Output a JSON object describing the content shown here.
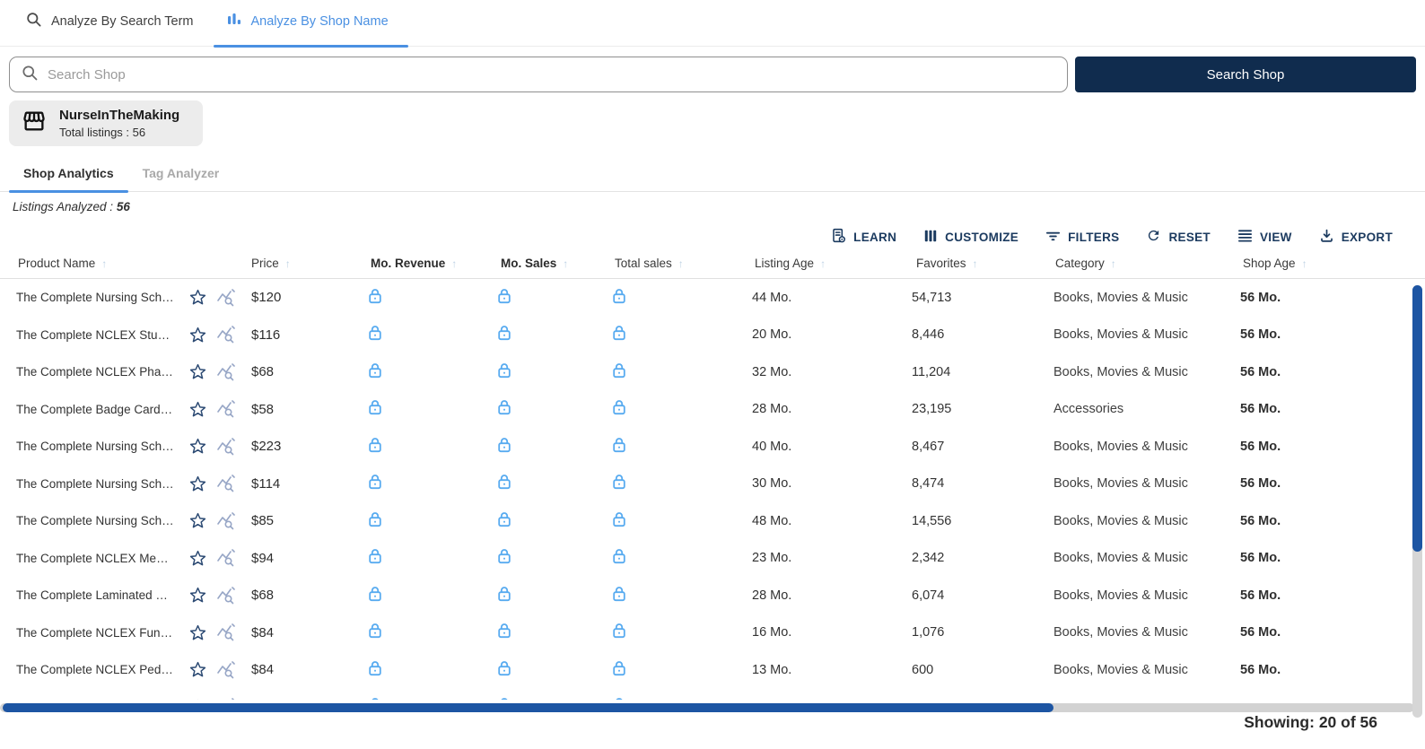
{
  "top_tabs": {
    "search_term": "Analyze By Search Term",
    "shop_name": "Analyze By Shop Name"
  },
  "search": {
    "placeholder": "Search Shop",
    "button_label": "Search Shop"
  },
  "shop_card": {
    "name": "NurseInTheMaking",
    "total_listings": "Total listings : 56"
  },
  "sub_tabs": {
    "shop_analytics": "Shop Analytics",
    "tag_analyzer": "Tag Analyzer"
  },
  "listings_analyzed": {
    "label": "Listings Analyzed : ",
    "value": "56"
  },
  "toolbar": {
    "learn": "LEARN",
    "customize": "CUSTOMIZE",
    "filters": "FILTERS",
    "reset": "RESET",
    "view": "VIEW",
    "export": "EXPORT"
  },
  "table": {
    "columns": [
      {
        "key": "product-name",
        "label": "Product Name",
        "bold": false
      },
      {
        "key": "price",
        "label": "Price",
        "bold": false
      },
      {
        "key": "mo-revenue",
        "label": "Mo. Revenue",
        "bold": true
      },
      {
        "key": "mo-sales",
        "label": "Mo. Sales",
        "bold": true
      },
      {
        "key": "total-sales",
        "label": "Total sales",
        "bold": false
      },
      {
        "key": "listing-age",
        "label": "Listing Age",
        "bold": false
      },
      {
        "key": "favorites",
        "label": "Favorites",
        "bold": false
      },
      {
        "key": "category",
        "label": "Category",
        "bold": false
      },
      {
        "key": "shop-age",
        "label": "Shop Age",
        "bold": false
      }
    ],
    "rows": [
      {
        "name": "The Complete Nursing Sch…",
        "price": "$120",
        "listing_age": "44 Mo.",
        "favorites": "54,713",
        "category": "Books, Movies & Music",
        "shop_age": "56 Mo."
      },
      {
        "name": "The Complete NCLEX Study …",
        "price": "$116",
        "listing_age": "20 Mo.",
        "favorites": "8,446",
        "category": "Books, Movies & Music",
        "shop_age": "56 Mo."
      },
      {
        "name": "The Complete NCLEX Phar…",
        "price": "$68",
        "listing_age": "32 Mo.",
        "favorites": "11,204",
        "category": "Books, Movies & Music",
        "shop_age": "56 Mo."
      },
      {
        "name": "The Complete Badge Card …",
        "price": "$58",
        "listing_age": "28 Mo.",
        "favorites": "23,195",
        "category": "Accessories",
        "shop_age": "56 Mo."
      },
      {
        "name": "The Complete Nursing Sch…",
        "price": "$223",
        "listing_age": "40 Mo.",
        "favorites": "8,467",
        "category": "Books, Movies & Music",
        "shop_age": "56 Mo."
      },
      {
        "name": "The Complete Nursing Sch…",
        "price": "$114",
        "listing_age": "30 Mo.",
        "favorites": "8,474",
        "category": "Books, Movies & Music",
        "shop_age": "56 Mo."
      },
      {
        "name": "The Complete Nursing Sch…",
        "price": "$85",
        "listing_age": "48 Mo.",
        "favorites": "14,556",
        "category": "Books, Movies & Music",
        "shop_age": "56 Mo."
      },
      {
        "name": "The Complete NCLEX Med S…",
        "price": "$94",
        "listing_age": "23 Mo.",
        "favorites": "2,342",
        "category": "Books, Movies & Music",
        "shop_age": "56 Mo."
      },
      {
        "name": "The Complete Laminated S…",
        "price": "$68",
        "listing_age": "28 Mo.",
        "favorites": "6,074",
        "category": "Books, Movies & Music",
        "shop_age": "56 Mo."
      },
      {
        "name": "The Complete NCLEX Funda…",
        "price": "$84",
        "listing_age": "16 Mo.",
        "favorites": "1,076",
        "category": "Books, Movies & Music",
        "shop_age": "56 Mo."
      },
      {
        "name": "The Complete NCLEX Pediat…",
        "price": "$84",
        "listing_age": "13 Mo.",
        "favorites": "600",
        "category": "Books, Movies & Music",
        "shop_age": "56 Mo."
      },
      {
        "name": "",
        "price": "",
        "listing_age": "",
        "favorites": "",
        "category": "",
        "shop_age": ""
      }
    ]
  },
  "footer": {
    "showing": "Showing: 20 of 56"
  },
  "colors": {
    "accent_blue": "#4a90e2",
    "navy_button": "#102c4e",
    "toolbar_navy": "#1b3a5f",
    "lock_blue": "#58abf0",
    "scrollbar_blue": "#1d55a3",
    "card_gray": "#ececec"
  }
}
